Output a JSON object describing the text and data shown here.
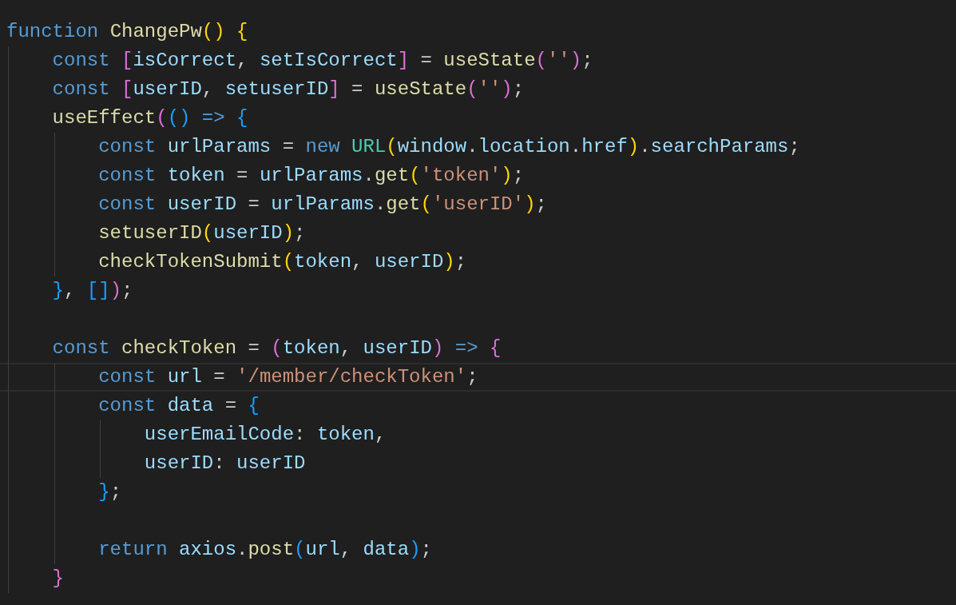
{
  "editor": {
    "lines": [
      {
        "kind": "code",
        "current": false,
        "tokens": [
          {
            "kind": "keyword",
            "text": "function "
          },
          {
            "kind": "function",
            "text": "ChangePw"
          },
          {
            "kind": "bracket-gold",
            "text": "() "
          },
          {
            "kind": "bracket-gold",
            "text": "{"
          }
        ],
        "children": [
          {
            "kind": "code",
            "current": false,
            "tokens": [
              {
                "kind": "keyword",
                "text": "const "
              },
              {
                "kind": "bracket-pink",
                "text": "["
              },
              {
                "kind": "variable",
                "text": "isCorrect"
              },
              {
                "kind": "plain",
                "text": ", "
              },
              {
                "kind": "variable",
                "text": "setIsCorrect"
              },
              {
                "kind": "bracket-pink",
                "text": "]"
              },
              {
                "kind": "plain",
                "text": " = "
              },
              {
                "kind": "function",
                "text": "useState"
              },
              {
                "kind": "bracket-pink",
                "text": "("
              },
              {
                "kind": "string",
                "text": "''"
              },
              {
                "kind": "bracket-pink",
                "text": ")"
              },
              {
                "kind": "plain",
                "text": ";"
              }
            ]
          },
          {
            "kind": "code",
            "current": false,
            "tokens": [
              {
                "kind": "keyword",
                "text": "const "
              },
              {
                "kind": "bracket-pink",
                "text": "["
              },
              {
                "kind": "variable",
                "text": "userID"
              },
              {
                "kind": "plain",
                "text": ", "
              },
              {
                "kind": "variable",
                "text": "setuserID"
              },
              {
                "kind": "bracket-pink",
                "text": "]"
              },
              {
                "kind": "plain",
                "text": " = "
              },
              {
                "kind": "function",
                "text": "useState"
              },
              {
                "kind": "bracket-pink",
                "text": "("
              },
              {
                "kind": "string",
                "text": "''"
              },
              {
                "kind": "bracket-pink",
                "text": ")"
              },
              {
                "kind": "plain",
                "text": ";"
              }
            ]
          },
          {
            "kind": "code",
            "current": false,
            "tokens": [
              {
                "kind": "function",
                "text": "useEffect"
              },
              {
                "kind": "bracket-pink",
                "text": "("
              },
              {
                "kind": "bracket-blue",
                "text": "() "
              },
              {
                "kind": "keyword",
                "text": "=> "
              },
              {
                "kind": "bracket-blue",
                "text": "{"
              }
            ],
            "children": [
              {
                "kind": "code",
                "current": false,
                "tokens": [
                  {
                    "kind": "keyword",
                    "text": "const "
                  },
                  {
                    "kind": "variable",
                    "text": "urlParams"
                  },
                  {
                    "kind": "plain",
                    "text": " = "
                  },
                  {
                    "kind": "keyword",
                    "text": "new "
                  },
                  {
                    "kind": "type",
                    "text": "URL"
                  },
                  {
                    "kind": "bracket-gold",
                    "text": "("
                  },
                  {
                    "kind": "variable",
                    "text": "window"
                  },
                  {
                    "kind": "plain",
                    "text": "."
                  },
                  {
                    "kind": "variable",
                    "text": "location"
                  },
                  {
                    "kind": "plain",
                    "text": "."
                  },
                  {
                    "kind": "variable",
                    "text": "href"
                  },
                  {
                    "kind": "bracket-gold",
                    "text": ")"
                  },
                  {
                    "kind": "plain",
                    "text": "."
                  },
                  {
                    "kind": "variable",
                    "text": "searchParams"
                  },
                  {
                    "kind": "plain",
                    "text": ";"
                  }
                ]
              },
              {
                "kind": "code",
                "current": false,
                "tokens": [
                  {
                    "kind": "keyword",
                    "text": "const "
                  },
                  {
                    "kind": "variable",
                    "text": "token"
                  },
                  {
                    "kind": "plain",
                    "text": " = "
                  },
                  {
                    "kind": "variable",
                    "text": "urlParams"
                  },
                  {
                    "kind": "plain",
                    "text": "."
                  },
                  {
                    "kind": "function",
                    "text": "get"
                  },
                  {
                    "kind": "bracket-gold",
                    "text": "("
                  },
                  {
                    "kind": "string",
                    "text": "'token'"
                  },
                  {
                    "kind": "bracket-gold",
                    "text": ")"
                  },
                  {
                    "kind": "plain",
                    "text": ";"
                  }
                ]
              },
              {
                "kind": "code",
                "current": false,
                "tokens": [
                  {
                    "kind": "keyword",
                    "text": "const "
                  },
                  {
                    "kind": "variable",
                    "text": "userID"
                  },
                  {
                    "kind": "plain",
                    "text": " = "
                  },
                  {
                    "kind": "variable",
                    "text": "urlParams"
                  },
                  {
                    "kind": "plain",
                    "text": "."
                  },
                  {
                    "kind": "function",
                    "text": "get"
                  },
                  {
                    "kind": "bracket-gold",
                    "text": "("
                  },
                  {
                    "kind": "string",
                    "text": "'userID'"
                  },
                  {
                    "kind": "bracket-gold",
                    "text": ")"
                  },
                  {
                    "kind": "plain",
                    "text": ";"
                  }
                ]
              },
              {
                "kind": "code",
                "current": false,
                "tokens": [
                  {
                    "kind": "function",
                    "text": "setuserID"
                  },
                  {
                    "kind": "bracket-gold",
                    "text": "("
                  },
                  {
                    "kind": "variable",
                    "text": "userID"
                  },
                  {
                    "kind": "bracket-gold",
                    "text": ")"
                  },
                  {
                    "kind": "plain",
                    "text": ";"
                  }
                ]
              },
              {
                "kind": "code",
                "current": false,
                "tokens": [
                  {
                    "kind": "function",
                    "text": "checkTokenSubmit"
                  },
                  {
                    "kind": "bracket-gold",
                    "text": "("
                  },
                  {
                    "kind": "variable",
                    "text": "token"
                  },
                  {
                    "kind": "plain",
                    "text": ", "
                  },
                  {
                    "kind": "variable",
                    "text": "userID"
                  },
                  {
                    "kind": "bracket-gold",
                    "text": ")"
                  },
                  {
                    "kind": "plain",
                    "text": ";"
                  }
                ]
              }
            ]
          },
          {
            "kind": "code",
            "current": false,
            "tokens": [
              {
                "kind": "bracket-blue",
                "text": "}"
              },
              {
                "kind": "plain",
                "text": ", "
              },
              {
                "kind": "bracket-blue",
                "text": "[]"
              },
              {
                "kind": "bracket-pink",
                "text": ")"
              },
              {
                "kind": "plain",
                "text": ";"
              }
            ]
          },
          {
            "kind": "blank",
            "current": false
          },
          {
            "kind": "code",
            "current": false,
            "tokens": [
              {
                "kind": "keyword",
                "text": "const "
              },
              {
                "kind": "function",
                "text": "checkToken"
              },
              {
                "kind": "plain",
                "text": " = "
              },
              {
                "kind": "bracket-pink",
                "text": "("
              },
              {
                "kind": "variable",
                "text": "token"
              },
              {
                "kind": "plain",
                "text": ", "
              },
              {
                "kind": "variable",
                "text": "userID"
              },
              {
                "kind": "bracket-pink",
                "text": ") "
              },
              {
                "kind": "keyword",
                "text": "=> "
              },
              {
                "kind": "bracket-pink",
                "text": "{"
              }
            ],
            "children": [
              {
                "kind": "code",
                "current": true,
                "tokens": [
                  {
                    "kind": "keyword",
                    "text": "const "
                  },
                  {
                    "kind": "variable",
                    "text": "url"
                  },
                  {
                    "kind": "plain",
                    "text": " = "
                  },
                  {
                    "kind": "string",
                    "text": "'/member/checkToken'"
                  },
                  {
                    "kind": "plain",
                    "text": ";"
                  }
                ]
              },
              {
                "kind": "code",
                "current": false,
                "tokens": [
                  {
                    "kind": "keyword",
                    "text": "const "
                  },
                  {
                    "kind": "variable",
                    "text": "data"
                  },
                  {
                    "kind": "plain",
                    "text": " = "
                  },
                  {
                    "kind": "bracket-blue",
                    "text": "{"
                  }
                ],
                "children": [
                  {
                    "kind": "code",
                    "current": false,
                    "tokens": [
                      {
                        "kind": "variable",
                        "text": "userEmailCode"
                      },
                      {
                        "kind": "plain",
                        "text": ": "
                      },
                      {
                        "kind": "variable",
                        "text": "token"
                      },
                      {
                        "kind": "plain",
                        "text": ","
                      }
                    ]
                  },
                  {
                    "kind": "code",
                    "current": false,
                    "tokens": [
                      {
                        "kind": "variable",
                        "text": "userID"
                      },
                      {
                        "kind": "plain",
                        "text": ": "
                      },
                      {
                        "kind": "variable",
                        "text": "userID"
                      }
                    ]
                  }
                ]
              },
              {
                "kind": "code",
                "current": false,
                "tokens": [
                  {
                    "kind": "bracket-blue",
                    "text": "}"
                  },
                  {
                    "kind": "plain",
                    "text": ";"
                  }
                ]
              },
              {
                "kind": "blank",
                "current": false
              },
              {
                "kind": "code",
                "current": false,
                "tokens": [
                  {
                    "kind": "keyword",
                    "text": "return "
                  },
                  {
                    "kind": "variable",
                    "text": "axios"
                  },
                  {
                    "kind": "plain",
                    "text": "."
                  },
                  {
                    "kind": "function",
                    "text": "post"
                  },
                  {
                    "kind": "bracket-blue",
                    "text": "("
                  },
                  {
                    "kind": "variable",
                    "text": "url"
                  },
                  {
                    "kind": "plain",
                    "text": ", "
                  },
                  {
                    "kind": "variable",
                    "text": "data"
                  },
                  {
                    "kind": "bracket-blue",
                    "text": ")"
                  },
                  {
                    "kind": "plain",
                    "text": ";"
                  }
                ]
              }
            ]
          },
          {
            "kind": "code",
            "current": false,
            "tokens": [
              {
                "kind": "bracket-pink",
                "text": "}"
              }
            ]
          }
        ]
      }
    ]
  }
}
